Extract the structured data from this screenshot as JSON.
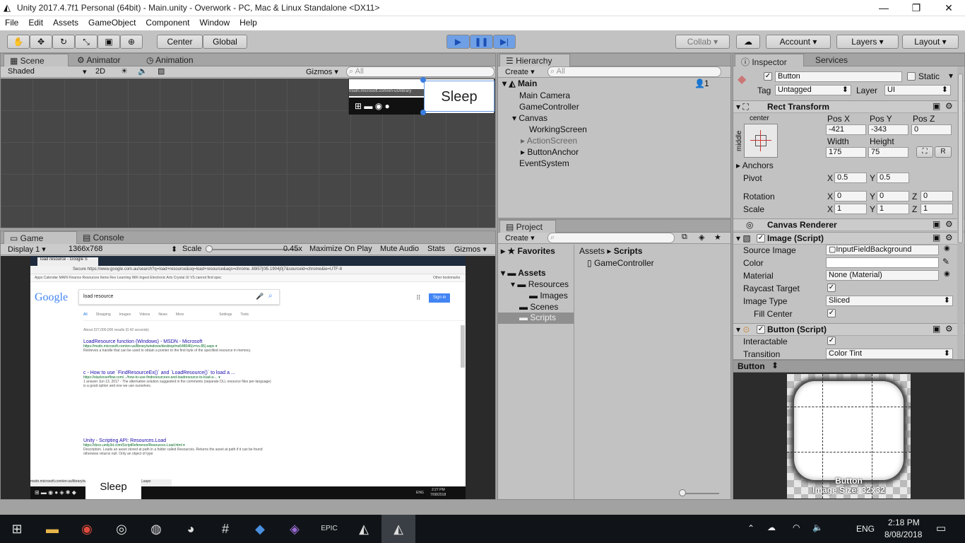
{
  "window": {
    "title": "Unity 2017.4.7f1 Personal (64bit) - Main.unity - Overwork - PC, Mac & Linux Standalone <DX11>",
    "minimize": "—",
    "maximize": "❐",
    "close": "✕"
  },
  "menu": [
    "File",
    "Edit",
    "Assets",
    "GameObject",
    "Component",
    "Window",
    "Help"
  ],
  "toolbar": {
    "center": "Center",
    "global": "Global",
    "play": "▶",
    "pause": "❚❚",
    "step": "▶|",
    "collab": "Collab",
    "account": "Account",
    "layers": "Layers",
    "layout": "Layout",
    "cloud": "☁"
  },
  "scene": {
    "tabs": [
      "Scene",
      "Animator",
      "Animation"
    ],
    "shaded": "Shaded",
    "mode2d": "2D",
    "gizmos": "Gizmos",
    "search_placeholder": "All",
    "sleep_label": "Sleep",
    "url": "msdn.microsoft.com/en-us/library"
  },
  "game": {
    "tabs": [
      "Game",
      "Console"
    ],
    "display": "Display 1",
    "resolution": "1366x768",
    "scale_label": "Scale",
    "scale_value": "0.45x",
    "max": "Maximize On Play",
    "mute": "Mute Audio",
    "stats": "Stats",
    "gizmos": "Gizmos",
    "sleep_label": "Sleep"
  },
  "browser": {
    "tab": "load resource - Google S",
    "url": "Secure  https://www.google.com.au/search?q=load+resource&oq=load+resource&aqs=chrome..69i57j0l5.1904j0j7&sourceid=chrome&ie=UTF-8",
    "bookmarks": "Apps  Calendar  MAIN  Finance  Resources  Items Rev Learning  WiK-Ingest  Electronic Arts  Crystal  UI  VS cannot find spec",
    "other_bookmarks": "Other bookmarks",
    "logo": "Google",
    "query": "load resource",
    "sign_in": "Sign in",
    "nav": [
      "All",
      "Shopping",
      "Images",
      "Videos",
      "News",
      "More",
      "Settings",
      "Tools"
    ],
    "stats": "About 227,000,000 results (0.42 seconds)",
    "results": [
      {
        "title": "LoadResource function (Windows) - MSDN - Microsoft",
        "url": "https://msdn.microsoft.com/en-us/library/windows/desktop/ms648046(v=vs.85).aspx ▾",
        "snippet": "Retrieves a handle that can be used to obtain a pointer to the first byte of the specified resource in memory."
      },
      {
        "title": "c - How to use `FindResourceEx()` and `LoadResource()` to load a ...",
        "url": "https://stackoverflow.com/.../how-to-use-findresourceex-and-loadresource-to-load-a-... ▾",
        "snippet": "1 answer  Jun 13, 2017 - The alternative solution suggested in the comments (separate DLL resource files per-language) is a good option and one we use ourselves."
      },
      {
        "title": "Unity - Scripting API: Resources.Load",
        "url": "https://docs.unity3d.com/ScriptReference/Resources.Load.html ▾",
        "snippet": "Description. Loads an asset stored at path in a folder called Resources. Returns the asset at path if it can be found otherwise returns null. Only an object of type"
      }
    ],
    "status_url": "msdn.microsoft.com/en-us/library/windows/desktop/ms648046(v=vs.85).aspx",
    "taskbar_time": "2:27 PM",
    "taskbar_date": "7/08/2018",
    "taskbar_lang": "ENG"
  },
  "hierarchy": {
    "tab": "Hierarchy",
    "create": "Create",
    "search_placeholder": "All",
    "scene": "Main",
    "items": [
      {
        "label": "Main Camera",
        "indent": 0
      },
      {
        "label": "GameController",
        "indent": 0
      },
      {
        "label": "Canvas",
        "indent": 0
      },
      {
        "label": "WorkingScreen",
        "indent": 1
      },
      {
        "label": "ActionScreen",
        "indent": 1
      },
      {
        "label": "ButtonAnchor",
        "indent": 1
      },
      {
        "label": "EventSystem",
        "indent": 0
      }
    ],
    "count": "1"
  },
  "project": {
    "tab": "Project",
    "create": "Create",
    "favorites": "Favorites",
    "assets": "Assets",
    "folders": [
      "Resources",
      "Images",
      "Scenes",
      "Scripts"
    ],
    "breadcrumb_root": "Assets",
    "breadcrumb_sep": "▸",
    "breadcrumb_current": "Scripts",
    "files": [
      "GameController"
    ]
  },
  "inspector": {
    "tabs": [
      "Inspector",
      "Services"
    ],
    "name": "Button",
    "static": "Static",
    "tag_label": "Tag",
    "tag": "Untagged",
    "layer_label": "Layer",
    "layer": "UI",
    "rect": {
      "title": "Rect Transform",
      "anchor": "center",
      "anchor_side": "middle",
      "posx_l": "Pos X",
      "posy_l": "Pos Y",
      "posz_l": "Pos Z",
      "posx": "-421",
      "posy": "-343",
      "posz": "0",
      "w_l": "Width",
      "h_l": "Height",
      "w": "175",
      "h": "75",
      "anchors": "Anchors",
      "pivot": "Pivot",
      "pivot_x": "0.5",
      "pivot_y": "0.5",
      "rotation": "Rotation",
      "rot": [
        "0",
        "0",
        "0"
      ],
      "scale": "Scale",
      "scl": [
        "1",
        "1",
        "1"
      ],
      "x": "X",
      "y": "Y",
      "z": "Z",
      "r": "R"
    },
    "canvas_renderer": "Canvas Renderer",
    "image": {
      "title": "Image (Script)",
      "source_l": "Source Image",
      "source": "InputFieldBackground",
      "color_l": "Color",
      "material_l": "Material",
      "material": "None (Material)",
      "raycast_l": "Raycast Target",
      "type_l": "Image Type",
      "type": "Sliced",
      "fill_l": "Fill Center"
    },
    "button": {
      "title": "Button (Script)",
      "interactable_l": "Interactable",
      "transition_l": "Transition",
      "transition": "Color Tint"
    },
    "preview": {
      "title": "Button",
      "name": "Button",
      "size": "Image Size: 32x32"
    }
  },
  "taskbar": {
    "time": "2:18 PM",
    "date": "8/08/2018",
    "lang": "ENG"
  }
}
